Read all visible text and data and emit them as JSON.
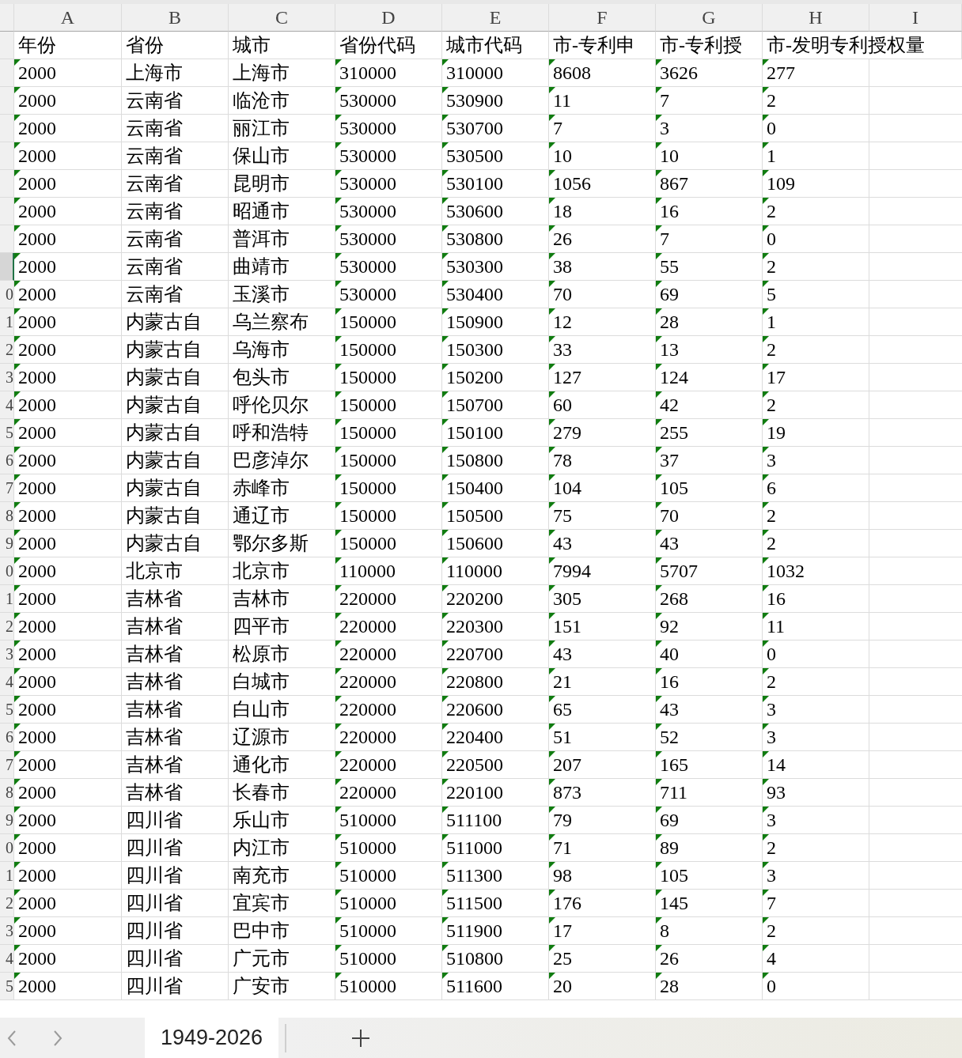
{
  "columns": [
    {
      "letter": "A"
    },
    {
      "letter": "B"
    },
    {
      "letter": "C"
    },
    {
      "letter": "D"
    },
    {
      "letter": "E"
    },
    {
      "letter": "F"
    },
    {
      "letter": "G"
    },
    {
      "letter": "H"
    },
    {
      "letter": "I"
    }
  ],
  "rows": [
    {
      "selected": false,
      "cells": [
        {
          "text": "年份",
          "flagged": false
        },
        {
          "text": "省份",
          "flagged": false
        },
        {
          "text": "城市",
          "flagged": false
        },
        {
          "text": "省份代码",
          "flagged": false
        },
        {
          "text": "城市代码",
          "flagged": false
        },
        {
          "text": "市-专利申",
          "flagged": false
        },
        {
          "text": "市-专利授",
          "flagged": false
        },
        {
          "text": "市-发明专利授权量",
          "flagged": false
        }
      ]
    },
    {
      "selected": false,
      "cells": [
        {
          "text": "2000",
          "flagged": true
        },
        {
          "text": "上海市",
          "flagged": false
        },
        {
          "text": "上海市",
          "flagged": false
        },
        {
          "text": "310000",
          "flagged": true
        },
        {
          "text": "310000",
          "flagged": true
        },
        {
          "text": "8608",
          "flagged": true
        },
        {
          "text": "3626",
          "flagged": true
        },
        {
          "text": "277",
          "flagged": true
        }
      ]
    },
    {
      "selected": false,
      "cells": [
        {
          "text": "2000",
          "flagged": true
        },
        {
          "text": "云南省",
          "flagged": false
        },
        {
          "text": "临沧市",
          "flagged": false
        },
        {
          "text": "530000",
          "flagged": true
        },
        {
          "text": "530900",
          "flagged": true
        },
        {
          "text": "11",
          "flagged": true
        },
        {
          "text": "7",
          "flagged": true
        },
        {
          "text": "2",
          "flagged": true
        }
      ]
    },
    {
      "selected": false,
      "cells": [
        {
          "text": "2000",
          "flagged": true
        },
        {
          "text": "云南省",
          "flagged": false
        },
        {
          "text": "丽江市",
          "flagged": false
        },
        {
          "text": "530000",
          "flagged": true
        },
        {
          "text": "530700",
          "flagged": true
        },
        {
          "text": "7",
          "flagged": true
        },
        {
          "text": "3",
          "flagged": true
        },
        {
          "text": "0",
          "flagged": true
        }
      ]
    },
    {
      "selected": false,
      "cells": [
        {
          "text": "2000",
          "flagged": true
        },
        {
          "text": "云南省",
          "flagged": false
        },
        {
          "text": "保山市",
          "flagged": false
        },
        {
          "text": "530000",
          "flagged": true
        },
        {
          "text": "530500",
          "flagged": true
        },
        {
          "text": "10",
          "flagged": true
        },
        {
          "text": "10",
          "flagged": true
        },
        {
          "text": "1",
          "flagged": true
        }
      ]
    },
    {
      "selected": false,
      "cells": [
        {
          "text": "2000",
          "flagged": true
        },
        {
          "text": "云南省",
          "flagged": false
        },
        {
          "text": "昆明市",
          "flagged": false
        },
        {
          "text": "530000",
          "flagged": true
        },
        {
          "text": "530100",
          "flagged": true
        },
        {
          "text": "1056",
          "flagged": true
        },
        {
          "text": "867",
          "flagged": true
        },
        {
          "text": "109",
          "flagged": true
        }
      ]
    },
    {
      "selected": false,
      "cells": [
        {
          "text": "2000",
          "flagged": true
        },
        {
          "text": "云南省",
          "flagged": false
        },
        {
          "text": "昭通市",
          "flagged": false
        },
        {
          "text": "530000",
          "flagged": true
        },
        {
          "text": "530600",
          "flagged": true
        },
        {
          "text": "18",
          "flagged": true
        },
        {
          "text": "16",
          "flagged": true
        },
        {
          "text": "2",
          "flagged": true
        }
      ]
    },
    {
      "selected": false,
      "cells": [
        {
          "text": "2000",
          "flagged": true
        },
        {
          "text": "云南省",
          "flagged": false
        },
        {
          "text": "普洱市",
          "flagged": false
        },
        {
          "text": "530000",
          "flagged": true
        },
        {
          "text": "530800",
          "flagged": true
        },
        {
          "text": "26",
          "flagged": true
        },
        {
          "text": "7",
          "flagged": true
        },
        {
          "text": "0",
          "flagged": true
        }
      ]
    },
    {
      "selected": true,
      "cells": [
        {
          "text": "2000",
          "flagged": true
        },
        {
          "text": "云南省",
          "flagged": false
        },
        {
          "text": "曲靖市",
          "flagged": false
        },
        {
          "text": "530000",
          "flagged": true
        },
        {
          "text": "530300",
          "flagged": true
        },
        {
          "text": "38",
          "flagged": true
        },
        {
          "text": "55",
          "flagged": true
        },
        {
          "text": "2",
          "flagged": true
        }
      ]
    },
    {
      "number": "0",
      "selected": false,
      "cells": [
        {
          "text": "2000",
          "flagged": true
        },
        {
          "text": "云南省",
          "flagged": false
        },
        {
          "text": "玉溪市",
          "flagged": false
        },
        {
          "text": "530000",
          "flagged": true
        },
        {
          "text": "530400",
          "flagged": true
        },
        {
          "text": "70",
          "flagged": true
        },
        {
          "text": "69",
          "flagged": true
        },
        {
          "text": "5",
          "flagged": true
        }
      ]
    },
    {
      "number": "1",
      "selected": false,
      "cells": [
        {
          "text": "2000",
          "flagged": true
        },
        {
          "text": "内蒙古自",
          "flagged": false
        },
        {
          "text": "乌兰察布",
          "flagged": false
        },
        {
          "text": "150000",
          "flagged": true
        },
        {
          "text": "150900",
          "flagged": true
        },
        {
          "text": "12",
          "flagged": true
        },
        {
          "text": "28",
          "flagged": true
        },
        {
          "text": "1",
          "flagged": true
        }
      ]
    },
    {
      "number": "2",
      "selected": false,
      "cells": [
        {
          "text": "2000",
          "flagged": true
        },
        {
          "text": "内蒙古自",
          "flagged": false
        },
        {
          "text": "乌海市",
          "flagged": false
        },
        {
          "text": "150000",
          "flagged": true
        },
        {
          "text": "150300",
          "flagged": true
        },
        {
          "text": "33",
          "flagged": true
        },
        {
          "text": "13",
          "flagged": true
        },
        {
          "text": "2",
          "flagged": true
        }
      ]
    },
    {
      "number": "3",
      "selected": false,
      "cells": [
        {
          "text": "2000",
          "flagged": true
        },
        {
          "text": "内蒙古自",
          "flagged": false
        },
        {
          "text": "包头市",
          "flagged": false
        },
        {
          "text": "150000",
          "flagged": true
        },
        {
          "text": "150200",
          "flagged": true
        },
        {
          "text": "127",
          "flagged": true
        },
        {
          "text": "124",
          "flagged": true
        },
        {
          "text": "17",
          "flagged": true
        }
      ]
    },
    {
      "number": "4",
      "selected": false,
      "cells": [
        {
          "text": "2000",
          "flagged": true
        },
        {
          "text": "内蒙古自",
          "flagged": false
        },
        {
          "text": "呼伦贝尔",
          "flagged": false
        },
        {
          "text": "150000",
          "flagged": true
        },
        {
          "text": "150700",
          "flagged": true
        },
        {
          "text": "60",
          "flagged": true
        },
        {
          "text": "42",
          "flagged": true
        },
        {
          "text": "2",
          "flagged": true
        }
      ]
    },
    {
      "number": "5",
      "selected": false,
      "cells": [
        {
          "text": "2000",
          "flagged": true
        },
        {
          "text": "内蒙古自",
          "flagged": false
        },
        {
          "text": "呼和浩特",
          "flagged": false
        },
        {
          "text": "150000",
          "flagged": true
        },
        {
          "text": "150100",
          "flagged": true
        },
        {
          "text": "279",
          "flagged": true
        },
        {
          "text": "255",
          "flagged": true
        },
        {
          "text": "19",
          "flagged": true
        }
      ]
    },
    {
      "number": "6",
      "selected": false,
      "cells": [
        {
          "text": "2000",
          "flagged": true
        },
        {
          "text": "内蒙古自",
          "flagged": false
        },
        {
          "text": "巴彦淖尔",
          "flagged": false
        },
        {
          "text": "150000",
          "flagged": true
        },
        {
          "text": "150800",
          "flagged": true
        },
        {
          "text": "78",
          "flagged": true
        },
        {
          "text": "37",
          "flagged": true
        },
        {
          "text": "3",
          "flagged": true
        }
      ]
    },
    {
      "number": "7",
      "selected": false,
      "cells": [
        {
          "text": "2000",
          "flagged": true
        },
        {
          "text": "内蒙古自",
          "flagged": false
        },
        {
          "text": "赤峰市",
          "flagged": false
        },
        {
          "text": "150000",
          "flagged": true
        },
        {
          "text": "150400",
          "flagged": true
        },
        {
          "text": "104",
          "flagged": true
        },
        {
          "text": "105",
          "flagged": true
        },
        {
          "text": "6",
          "flagged": true
        }
      ]
    },
    {
      "number": "8",
      "selected": false,
      "cells": [
        {
          "text": "2000",
          "flagged": true
        },
        {
          "text": "内蒙古自",
          "flagged": false
        },
        {
          "text": "通辽市",
          "flagged": false
        },
        {
          "text": "150000",
          "flagged": true
        },
        {
          "text": "150500",
          "flagged": true
        },
        {
          "text": "75",
          "flagged": true
        },
        {
          "text": "70",
          "flagged": true
        },
        {
          "text": "2",
          "flagged": true
        }
      ]
    },
    {
      "number": "9",
      "selected": false,
      "cells": [
        {
          "text": "2000",
          "flagged": true
        },
        {
          "text": "内蒙古自",
          "flagged": false
        },
        {
          "text": "鄂尔多斯",
          "flagged": false
        },
        {
          "text": "150000",
          "flagged": true
        },
        {
          "text": "150600",
          "flagged": true
        },
        {
          "text": "43",
          "flagged": true
        },
        {
          "text": "43",
          "flagged": true
        },
        {
          "text": "2",
          "flagged": true
        }
      ]
    },
    {
      "number": "0",
      "selected": false,
      "cells": [
        {
          "text": "2000",
          "flagged": true
        },
        {
          "text": "北京市",
          "flagged": false
        },
        {
          "text": "北京市",
          "flagged": false
        },
        {
          "text": "110000",
          "flagged": true
        },
        {
          "text": "110000",
          "flagged": true
        },
        {
          "text": "7994",
          "flagged": true
        },
        {
          "text": "5707",
          "flagged": true
        },
        {
          "text": "1032",
          "flagged": true
        }
      ]
    },
    {
      "number": "1",
      "selected": false,
      "cells": [
        {
          "text": "2000",
          "flagged": true
        },
        {
          "text": "吉林省",
          "flagged": false
        },
        {
          "text": "吉林市",
          "flagged": false
        },
        {
          "text": "220000",
          "flagged": true
        },
        {
          "text": "220200",
          "flagged": true
        },
        {
          "text": "305",
          "flagged": true
        },
        {
          "text": "268",
          "flagged": true
        },
        {
          "text": "16",
          "flagged": true
        }
      ]
    },
    {
      "number": "2",
      "selected": false,
      "cells": [
        {
          "text": "2000",
          "flagged": true
        },
        {
          "text": "吉林省",
          "flagged": false
        },
        {
          "text": "四平市",
          "flagged": false
        },
        {
          "text": "220000",
          "flagged": true
        },
        {
          "text": "220300",
          "flagged": true
        },
        {
          "text": "151",
          "flagged": true
        },
        {
          "text": "92",
          "flagged": true
        },
        {
          "text": "11",
          "flagged": true
        }
      ]
    },
    {
      "number": "3",
      "selected": false,
      "cells": [
        {
          "text": "2000",
          "flagged": true
        },
        {
          "text": "吉林省",
          "flagged": false
        },
        {
          "text": "松原市",
          "flagged": false
        },
        {
          "text": "220000",
          "flagged": true
        },
        {
          "text": "220700",
          "flagged": true
        },
        {
          "text": "43",
          "flagged": true
        },
        {
          "text": "40",
          "flagged": true
        },
        {
          "text": "0",
          "flagged": true
        }
      ]
    },
    {
      "number": "4",
      "selected": false,
      "cells": [
        {
          "text": "2000",
          "flagged": true
        },
        {
          "text": "吉林省",
          "flagged": false
        },
        {
          "text": "白城市",
          "flagged": false
        },
        {
          "text": "220000",
          "flagged": true
        },
        {
          "text": "220800",
          "flagged": true
        },
        {
          "text": "21",
          "flagged": true
        },
        {
          "text": "16",
          "flagged": true
        },
        {
          "text": "2",
          "flagged": true
        }
      ]
    },
    {
      "number": "5",
      "selected": false,
      "cells": [
        {
          "text": "2000",
          "flagged": true
        },
        {
          "text": "吉林省",
          "flagged": false
        },
        {
          "text": "白山市",
          "flagged": false
        },
        {
          "text": "220000",
          "flagged": true
        },
        {
          "text": "220600",
          "flagged": true
        },
        {
          "text": "65",
          "flagged": true
        },
        {
          "text": "43",
          "flagged": true
        },
        {
          "text": "3",
          "flagged": true
        }
      ]
    },
    {
      "number": "6",
      "selected": false,
      "cells": [
        {
          "text": "2000",
          "flagged": true
        },
        {
          "text": "吉林省",
          "flagged": false
        },
        {
          "text": "辽源市",
          "flagged": false
        },
        {
          "text": "220000",
          "flagged": true
        },
        {
          "text": "220400",
          "flagged": true
        },
        {
          "text": "51",
          "flagged": true
        },
        {
          "text": "52",
          "flagged": true
        },
        {
          "text": "3",
          "flagged": true
        }
      ]
    },
    {
      "number": "7",
      "selected": false,
      "cells": [
        {
          "text": "2000",
          "flagged": true
        },
        {
          "text": "吉林省",
          "flagged": false
        },
        {
          "text": "通化市",
          "flagged": false
        },
        {
          "text": "220000",
          "flagged": true
        },
        {
          "text": "220500",
          "flagged": true
        },
        {
          "text": "207",
          "flagged": true
        },
        {
          "text": "165",
          "flagged": true
        },
        {
          "text": "14",
          "flagged": true
        }
      ]
    },
    {
      "number": "8",
      "selected": false,
      "cells": [
        {
          "text": "2000",
          "flagged": true
        },
        {
          "text": "吉林省",
          "flagged": false
        },
        {
          "text": "长春市",
          "flagged": false
        },
        {
          "text": "220000",
          "flagged": true
        },
        {
          "text": "220100",
          "flagged": true
        },
        {
          "text": "873",
          "flagged": true
        },
        {
          "text": "711",
          "flagged": true
        },
        {
          "text": "93",
          "flagged": true
        }
      ]
    },
    {
      "number": "9",
      "selected": false,
      "cells": [
        {
          "text": "2000",
          "flagged": true
        },
        {
          "text": "四川省",
          "flagged": false
        },
        {
          "text": "乐山市",
          "flagged": false
        },
        {
          "text": "510000",
          "flagged": true
        },
        {
          "text": "511100",
          "flagged": true
        },
        {
          "text": "79",
          "flagged": true
        },
        {
          "text": "69",
          "flagged": true
        },
        {
          "text": "3",
          "flagged": true
        }
      ]
    },
    {
      "number": "0",
      "selected": false,
      "cells": [
        {
          "text": "2000",
          "flagged": true
        },
        {
          "text": "四川省",
          "flagged": false
        },
        {
          "text": "内江市",
          "flagged": false
        },
        {
          "text": "510000",
          "flagged": true
        },
        {
          "text": "511000",
          "flagged": true
        },
        {
          "text": "71",
          "flagged": true
        },
        {
          "text": "89",
          "flagged": true
        },
        {
          "text": "2",
          "flagged": true
        }
      ]
    },
    {
      "number": "1",
      "selected": false,
      "cells": [
        {
          "text": "2000",
          "flagged": true
        },
        {
          "text": "四川省",
          "flagged": false
        },
        {
          "text": "南充市",
          "flagged": false
        },
        {
          "text": "510000",
          "flagged": true
        },
        {
          "text": "511300",
          "flagged": true
        },
        {
          "text": "98",
          "flagged": true
        },
        {
          "text": "105",
          "flagged": true
        },
        {
          "text": "3",
          "flagged": true
        }
      ]
    },
    {
      "number": "2",
      "selected": false,
      "cells": [
        {
          "text": "2000",
          "flagged": true
        },
        {
          "text": "四川省",
          "flagged": false
        },
        {
          "text": "宜宾市",
          "flagged": false
        },
        {
          "text": "510000",
          "flagged": true
        },
        {
          "text": "511500",
          "flagged": true
        },
        {
          "text": "176",
          "flagged": true
        },
        {
          "text": "145",
          "flagged": true
        },
        {
          "text": "7",
          "flagged": true
        }
      ]
    },
    {
      "number": "3",
      "selected": false,
      "cells": [
        {
          "text": "2000",
          "flagged": true
        },
        {
          "text": "四川省",
          "flagged": false
        },
        {
          "text": "巴中市",
          "flagged": false
        },
        {
          "text": "510000",
          "flagged": true
        },
        {
          "text": "511900",
          "flagged": true
        },
        {
          "text": "17",
          "flagged": true
        },
        {
          "text": "8",
          "flagged": true
        },
        {
          "text": "2",
          "flagged": true
        }
      ]
    },
    {
      "number": "4",
      "selected": false,
      "cells": [
        {
          "text": "2000",
          "flagged": true
        },
        {
          "text": "四川省",
          "flagged": false
        },
        {
          "text": "广元市",
          "flagged": false
        },
        {
          "text": "510000",
          "flagged": true
        },
        {
          "text": "510800",
          "flagged": true
        },
        {
          "text": "25",
          "flagged": true
        },
        {
          "text": "26",
          "flagged": true
        },
        {
          "text": "4",
          "flagged": true
        }
      ]
    },
    {
      "number": "5",
      "selected": false,
      "cells": [
        {
          "text": "2000",
          "flagged": true
        },
        {
          "text": "四川省",
          "flagged": false
        },
        {
          "text": "广安市",
          "flagged": false
        },
        {
          "text": "510000",
          "flagged": true
        },
        {
          "text": "511600",
          "flagged": true
        },
        {
          "text": "20",
          "flagged": true
        },
        {
          "text": "28",
          "flagged": true
        },
        {
          "text": "0",
          "flagged": true
        }
      ]
    }
  ],
  "sheet_tabs": [
    {
      "label": "1949-2026",
      "selected": true
    }
  ]
}
